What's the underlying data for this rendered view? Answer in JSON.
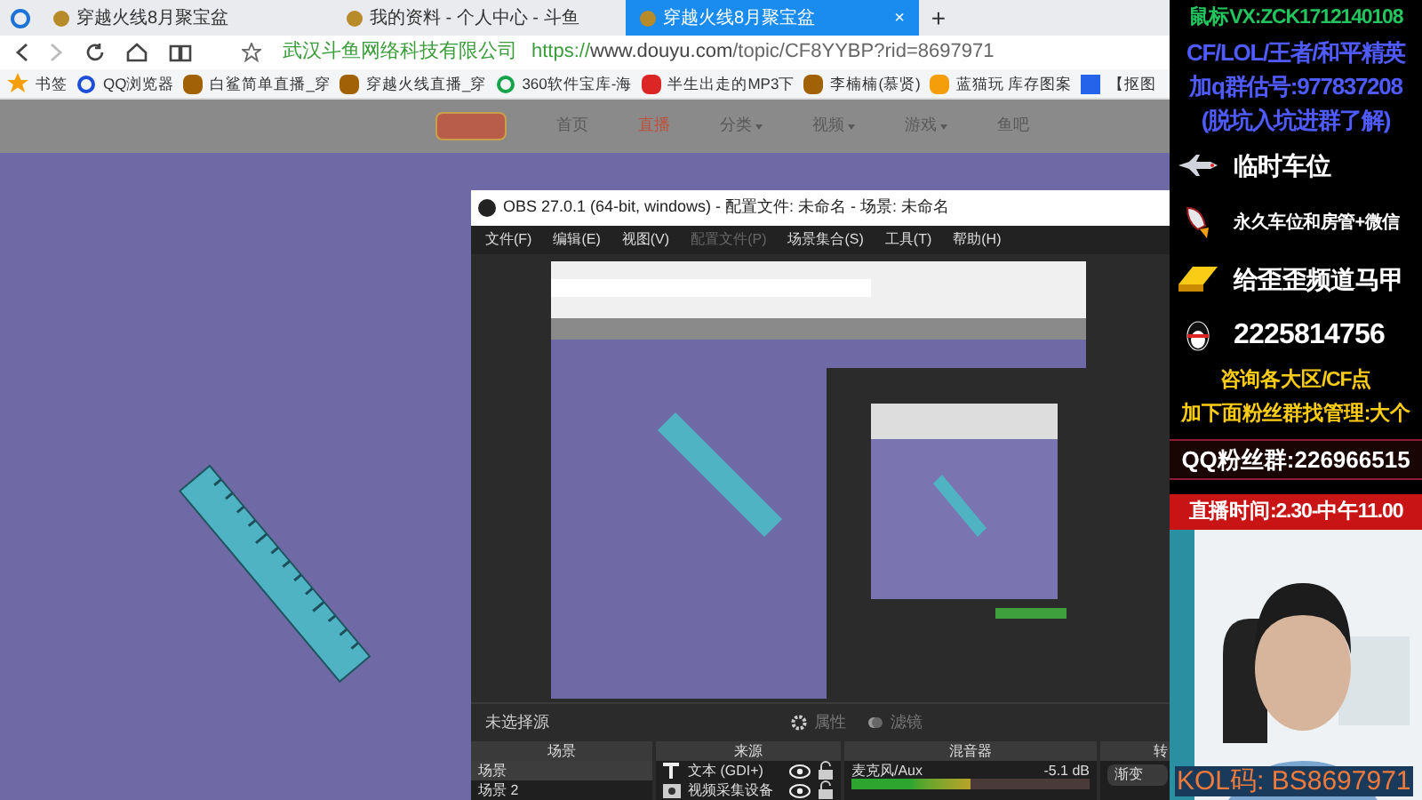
{
  "browser": {
    "tabs": [
      {
        "title": "穿越火线8月聚宝盆",
        "selected": false
      },
      {
        "title": "我的资料 - 个人中心 - 斗鱼",
        "selected": false
      },
      {
        "title": "穿越火线8月聚宝盆",
        "selected": true
      }
    ],
    "close_tab": "×",
    "new_tab": "+",
    "address": {
      "site_name": "武汉斗鱼网络科技有限公司",
      "scheme": "https://",
      "host": "www.douyu.com",
      "path": "/topic/CF8YYBP?rid=8697971"
    },
    "bookmarks": [
      {
        "label": "书签",
        "kind": "star"
      },
      {
        "label": "QQ浏览器",
        "kind": "browser"
      },
      {
        "label": "白鲨简单直播_穿",
        "kind": "site"
      },
      {
        "label": "穿越火线直播_穿",
        "kind": "site"
      },
      {
        "label": "360软件宝库-海",
        "kind": "ring"
      },
      {
        "label": "半生出走的MP3下",
        "kind": "play"
      },
      {
        "label": "李楠楠(慕贤)",
        "kind": "site"
      },
      {
        "label": "蓝猫玩 库存图案",
        "kind": "cat"
      },
      {
        "label": "【抠图",
        "kind": "doc"
      }
    ]
  },
  "site_nav": [
    {
      "label": "首页",
      "selected": false,
      "has_menu": false
    },
    {
      "label": "直播",
      "selected": true,
      "has_menu": false
    },
    {
      "label": "分类",
      "selected": false,
      "has_menu": true
    },
    {
      "label": "视频",
      "selected": false,
      "has_menu": true
    },
    {
      "label": "游戏",
      "selected": false,
      "has_menu": true
    },
    {
      "label": "鱼吧",
      "selected": false,
      "has_menu": false
    }
  ],
  "obs": {
    "title": "OBS 27.0.1 (64-bit, windows) - 配置文件: 未命名 - 场景: 未命名",
    "menu": [
      {
        "label": "文件(F)",
        "disabled": false
      },
      {
        "label": "编辑(E)",
        "disabled": false
      },
      {
        "label": "视图(V)",
        "disabled": false
      },
      {
        "label": "配置文件(P)",
        "disabled": true
      },
      {
        "label": "场景集合(S)",
        "disabled": false
      },
      {
        "label": "工具(T)",
        "disabled": false
      },
      {
        "label": "帮助(H)",
        "disabled": false
      }
    ],
    "source_bar": {
      "label": "未选择源",
      "buttons": [
        {
          "label": "属性",
          "kind": "gear"
        },
        {
          "label": "滤镜",
          "kind": "filter"
        }
      ]
    },
    "scenes": {
      "title": "场景",
      "items": [
        {
          "label": "场景",
          "selected": true
        },
        {
          "label": "场景 2",
          "selected": false
        }
      ]
    },
    "sources": {
      "title": "来源",
      "items": [
        {
          "kind": "text",
          "label": "文本 (GDI+)",
          "visible": true,
          "locked": false
        },
        {
          "kind": "camera",
          "label": "视频采集设备",
          "visible": true,
          "locked": false
        }
      ]
    },
    "mixer": {
      "title": "混音器",
      "channels": [
        {
          "name": "麦克风/Aux",
          "reading": "-5.1 dB",
          "level": 0.5
        }
      ]
    },
    "transitions": {
      "title": "转",
      "button": "渐变"
    }
  },
  "promo": {
    "lines": [
      {
        "text": "鼠标VX:ZCK1712140108",
        "color": "#22c55e",
        "kind": "plain"
      },
      {
        "text": "CF/LOL/王者/和平精英",
        "color": "#4f5bff",
        "kind": "plain"
      },
      {
        "text": "加q群估号:977837208",
        "color": "#4f5bff",
        "kind": "plain"
      },
      {
        "text": "(脱坑入坑进群了解)",
        "color": "#4f5bff",
        "kind": "plain"
      },
      {
        "text": "临时车位",
        "color": "#ffffff",
        "kind": "jet"
      },
      {
        "text": "永久车位和房管+微信",
        "color": "#ffffff",
        "kind": "rocket"
      },
      {
        "text": "给歪歪频道马甲",
        "color": "#ffffff",
        "kind": "gold"
      },
      {
        "text": "2225814756",
        "color": "#ffffff",
        "kind": "penguin"
      },
      {
        "text": "咨询各大区/CF点",
        "color": "#facc15",
        "kind": "plain"
      },
      {
        "text": "加下面粉丝群找管理:大个",
        "color": "#facc15",
        "kind": "plain"
      },
      {
        "text": "QQ粉丝群:226966515",
        "color": "#ffffff",
        "kind": "glow"
      },
      {
        "text": "直播时间:2.30-中午11.00",
        "color": "#ffffff",
        "kind": "alert"
      }
    ]
  },
  "webcam": {
    "kind": "picture",
    "caption": "KOL码: BS8697971"
  }
}
